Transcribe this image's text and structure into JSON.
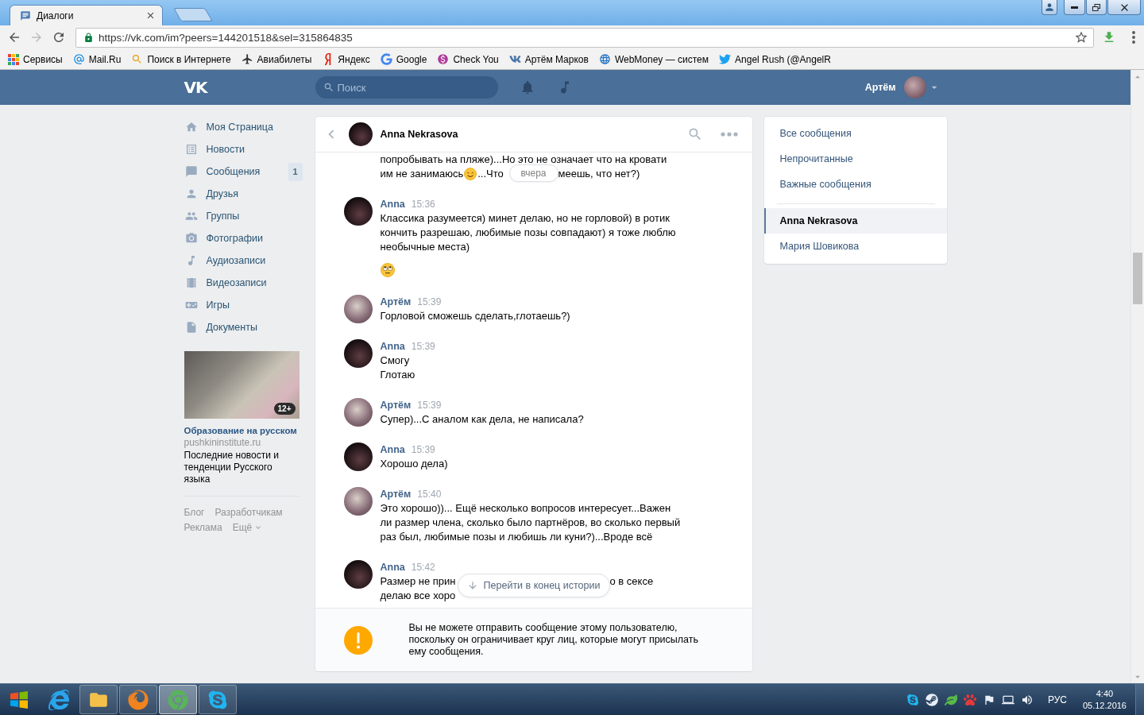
{
  "browser": {
    "tabs": [
      {
        "title": "Диалоги",
        "selected": true
      }
    ],
    "nav_buttons": [
      {
        "kind": "back",
        "disabled": false
      },
      {
        "kind": "forward",
        "disabled": true
      },
      {
        "kind": "reload",
        "disabled": false
      }
    ],
    "address": "https://vk.com/im?peers=144201518&sel=315864835",
    "bookmarks": [
      {
        "kind": "apps",
        "label": "Сервисы"
      },
      {
        "kind": "mail",
        "label": "Mail.Ru"
      },
      {
        "kind": "search",
        "label": "Поиск в Интернете"
      },
      {
        "kind": "plane",
        "label": "Авиабилеты"
      },
      {
        "kind": "yandex",
        "label": "Яндекс"
      },
      {
        "kind": "google",
        "label": "Google"
      },
      {
        "kind": "money",
        "label": "Check You"
      },
      {
        "kind": "vk",
        "label": "Артём Марков"
      },
      {
        "kind": "globe",
        "label": "WebMoney — систем"
      },
      {
        "kind": "bird",
        "label": "Angel Rush (@AngelR"
      }
    ]
  },
  "header": {
    "logo": "VK",
    "search_placeholder": "Поиск",
    "user_name": "Артём"
  },
  "sidebar": {
    "items": [
      {
        "kind": "home",
        "label": "Моя Страница"
      },
      {
        "kind": "news",
        "label": "Новости"
      },
      {
        "kind": "messages",
        "label": "Сообщения",
        "badge": "1"
      },
      {
        "kind": "friends",
        "label": "Друзья"
      },
      {
        "kind": "groups",
        "label": "Группы"
      },
      {
        "kind": "photos",
        "label": "Фотографии"
      },
      {
        "kind": "audio",
        "label": "Аудиозаписи"
      },
      {
        "kind": "video",
        "label": "Видеозаписи"
      },
      {
        "kind": "games",
        "label": "Игры"
      },
      {
        "kind": "docs",
        "label": "Документы"
      }
    ],
    "ad": {
      "age_badge": "12+",
      "title": "Образование на русском",
      "domain": "pushkininstitute.ru",
      "text": "Последние новости и тенденции Русского языка"
    },
    "footer_links": [
      {
        "label": "Блог",
        "dropdown": false
      },
      {
        "label": "Разработчикам",
        "dropdown": false
      },
      {
        "label": "Реклама",
        "dropdown": false
      },
      {
        "label": "Ещё",
        "dropdown": true
      }
    ]
  },
  "chat": {
    "contact_name": "Anna Nekrasova",
    "date_label": "вчера",
    "messages": [
      {
        "blocks": [
          {
            "kind": "text",
            "text": "попробывать на пляже)...Но это не означает что на кровати"
          },
          {
            "kind": "datesplit",
            "before": [
              {
                "kind": "text",
                "text": "им не занимаюсь"
              },
              {
                "kind": "smile"
              },
              {
                "kind": "text",
                "text": "...Что"
              }
            ],
            "after": "меешь, что нет?)"
          }
        ]
      },
      {
        "kind": "incoming",
        "name": "Anna",
        "time": "15:36",
        "blocks": [
          {
            "kind": "text",
            "text": "Классика разумеется) минет делаю, но не горловой) в ротик\nкончить разрешаю, любимые позы совпадают) я тоже люблю\nнеобычные места)"
          },
          {
            "kind": "eyeroll"
          }
        ]
      },
      {
        "kind": "outgoing",
        "name": "Артём",
        "time": "15:39",
        "blocks": [
          {
            "kind": "text",
            "text": "Горловой сможешь сделать,глотаешь?)"
          }
        ]
      },
      {
        "kind": "incoming",
        "name": "Anna",
        "time": "15:39",
        "blocks": [
          {
            "kind": "text",
            "text": "Смогу\nГлотаю"
          }
        ]
      },
      {
        "kind": "outgoing",
        "name": "Артём",
        "time": "15:39",
        "blocks": [
          {
            "kind": "text",
            "text": "Супер)...С аналом как дела, не написала?"
          }
        ]
      },
      {
        "kind": "incoming",
        "name": "Anna",
        "time": "15:39",
        "blocks": [
          {
            "kind": "text",
            "text": "Хорошо дела)"
          }
        ]
      },
      {
        "kind": "outgoing",
        "name": "Артём",
        "time": "15:40",
        "blocks": [
          {
            "kind": "text",
            "text": "Это хорошо))... Ещё несколько вопросов интересует...Важен\nли размер члена, сколько было партнёров, во сколько первый\nраз был, любимые позы и любишь ли куни?)...Вроде всё"
          }
        ]
      },
      {
        "kind": "incoming",
        "name": "Anna",
        "time": "15:42",
        "blocks": [
          {
            "kind": "jumpsplit",
            "before": [
              {
                "kind": "text",
                "text": "Размер не прин"
              }
            ],
            "after": "о в сексе"
          },
          {
            "kind": "jumpsplit",
            "before": [
              {
                "kind": "text",
                "text": "делаю все хоро"
              }
            ]
          }
        ]
      }
    ],
    "jump_button": "Перейти в конец истории",
    "notice": "Вы не можете отправить сообщение этому пользователю,\nпоскольку он ограничивает круг лиц, которые могут присылать\nему сообщения."
  },
  "right_menu": {
    "filters": [
      {
        "label": "Все сообщения",
        "selected": false
      },
      {
        "label": "Непрочитанные",
        "selected": false
      },
      {
        "label": "Важные сообщения",
        "selected": false
      }
    ],
    "dialogs": [
      {
        "label": "Anna Nekrasova",
        "selected": true
      },
      {
        "label": "Мария Шовикова",
        "selected": false
      }
    ]
  },
  "taskbar": {
    "apps": [
      {
        "kind": "ie",
        "running": false,
        "selected": false
      },
      {
        "kind": "explorer",
        "running": true,
        "selected": false
      },
      {
        "kind": "firefox",
        "running": true,
        "selected": false
      },
      {
        "kind": "chrome",
        "running": true,
        "selected": true
      },
      {
        "kind": "skype",
        "running": true,
        "selected": false
      }
    ],
    "tray": {
      "language": "РУС",
      "time": "4:40",
      "date": "05.12.2016"
    }
  }
}
